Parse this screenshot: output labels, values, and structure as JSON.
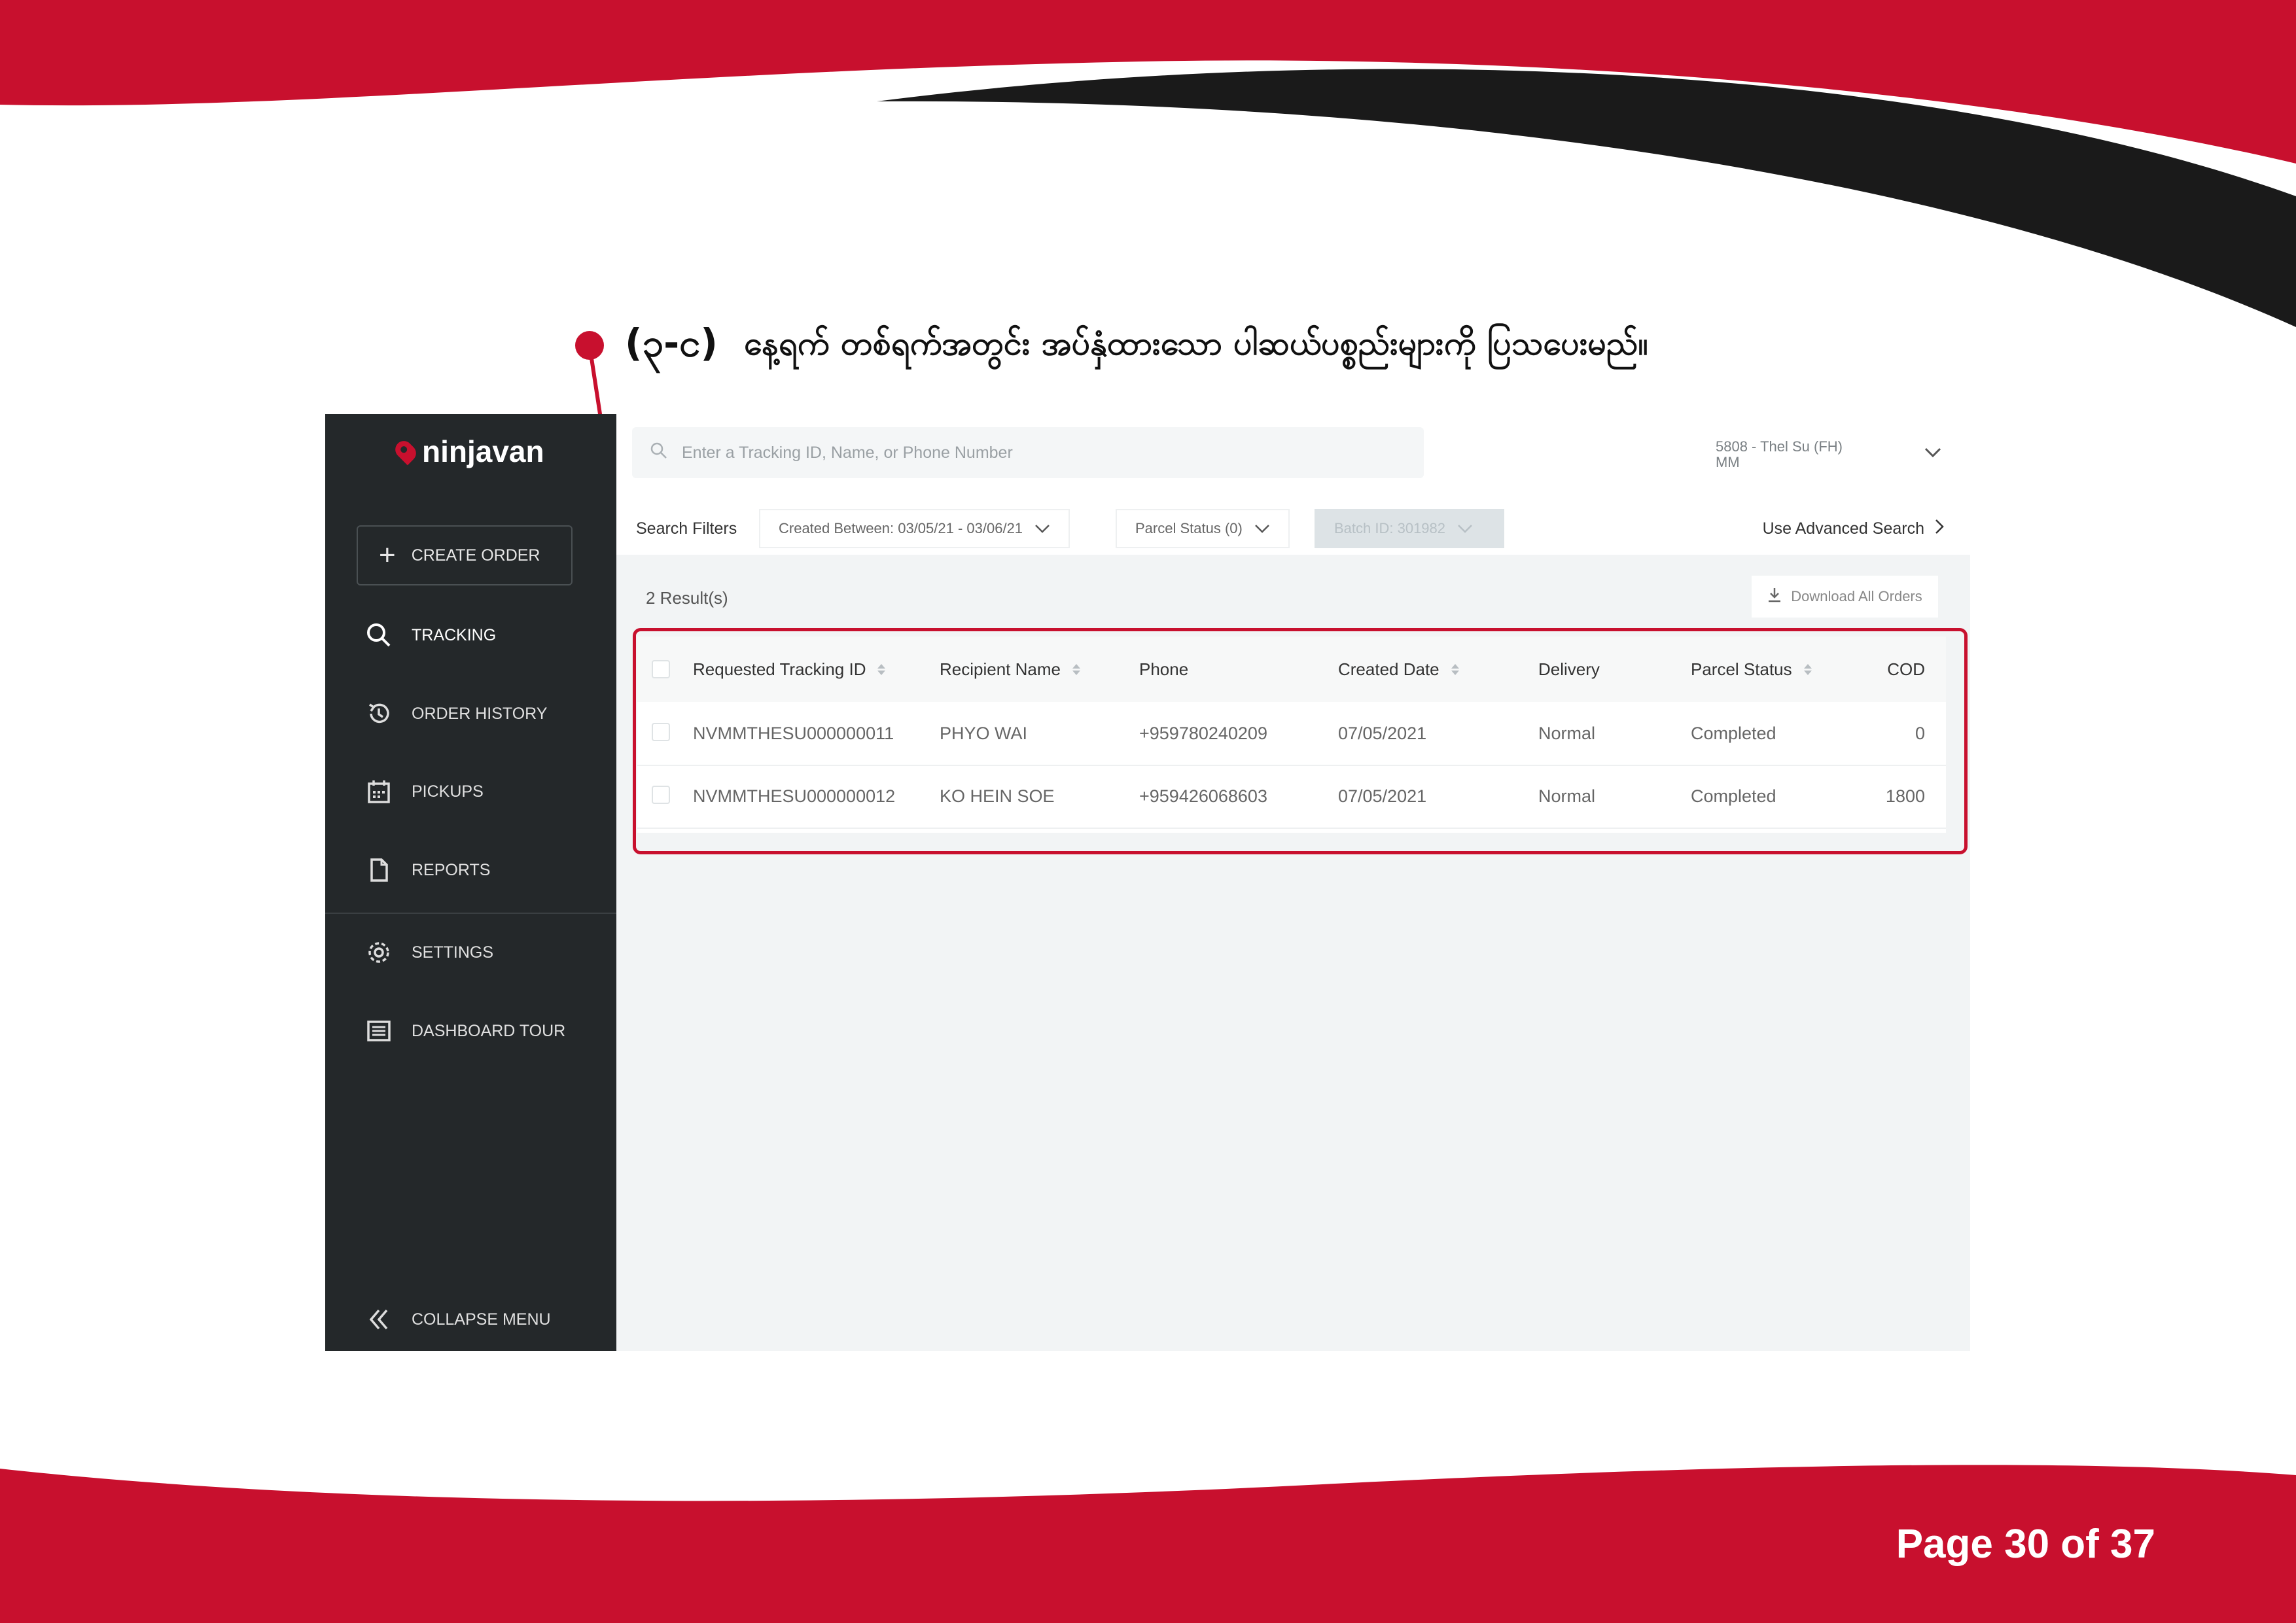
{
  "colors": {
    "brand_red": "#c8102e",
    "sidebar_bg": "#24282a",
    "black_swoosh": "#1a1a1a"
  },
  "document": {
    "heading_number": "(၃-င)",
    "heading_text": "နေ့ရက် တစ်ရက်အတွင်း အပ်နှံထားသော ပါဆယ်ပစ္စည်းများကို ပြသပေးမည်။",
    "page_label": "Page 30 of 37"
  },
  "app": {
    "logo_text": "ninjavan",
    "sidebar": {
      "create_order": "CREATE ORDER",
      "items": [
        {
          "label": "TRACKING",
          "icon": "search-icon"
        },
        {
          "label": "ORDER HISTORY",
          "icon": "history-icon"
        },
        {
          "label": "PICKUPS",
          "icon": "calendar-icon"
        },
        {
          "label": "REPORTS",
          "icon": "document-icon"
        },
        {
          "label": "SETTINGS",
          "icon": "gear-icon"
        },
        {
          "label": "DASHBOARD TOUR",
          "icon": "list-icon"
        }
      ],
      "collapse": "COLLAPSE MENU"
    },
    "search": {
      "placeholder": "Enter a Tracking ID, Name, or Phone Number"
    },
    "account": {
      "line1": "5808 - Thel Su (FH)",
      "line2": "MM"
    },
    "filters": {
      "label": "Search Filters",
      "created_between": "Created Between: 03/05/21 - 03/06/21",
      "parcel_status": "Parcel Status (0)",
      "batch_id": "Batch ID: 301982",
      "advanced": "Use Advanced Search"
    },
    "results": {
      "count_label": "2 Result(s)",
      "download_label": "Download All Orders",
      "columns": [
        "Requested Tracking ID",
        "Recipient Name",
        "Phone",
        "Created Date",
        "Delivery",
        "Parcel Status",
        "COD"
      ],
      "rows": [
        [
          "NVMMTHESU000000011",
          "PHYO WAI",
          "+959780240209",
          "07/05/2021",
          "Normal",
          "Completed",
          "0"
        ],
        [
          "NVMMTHESU000000012",
          "KO HEIN SOE",
          "+959426068603",
          "07/05/2021",
          "Normal",
          "Completed",
          "1800"
        ]
      ]
    }
  }
}
